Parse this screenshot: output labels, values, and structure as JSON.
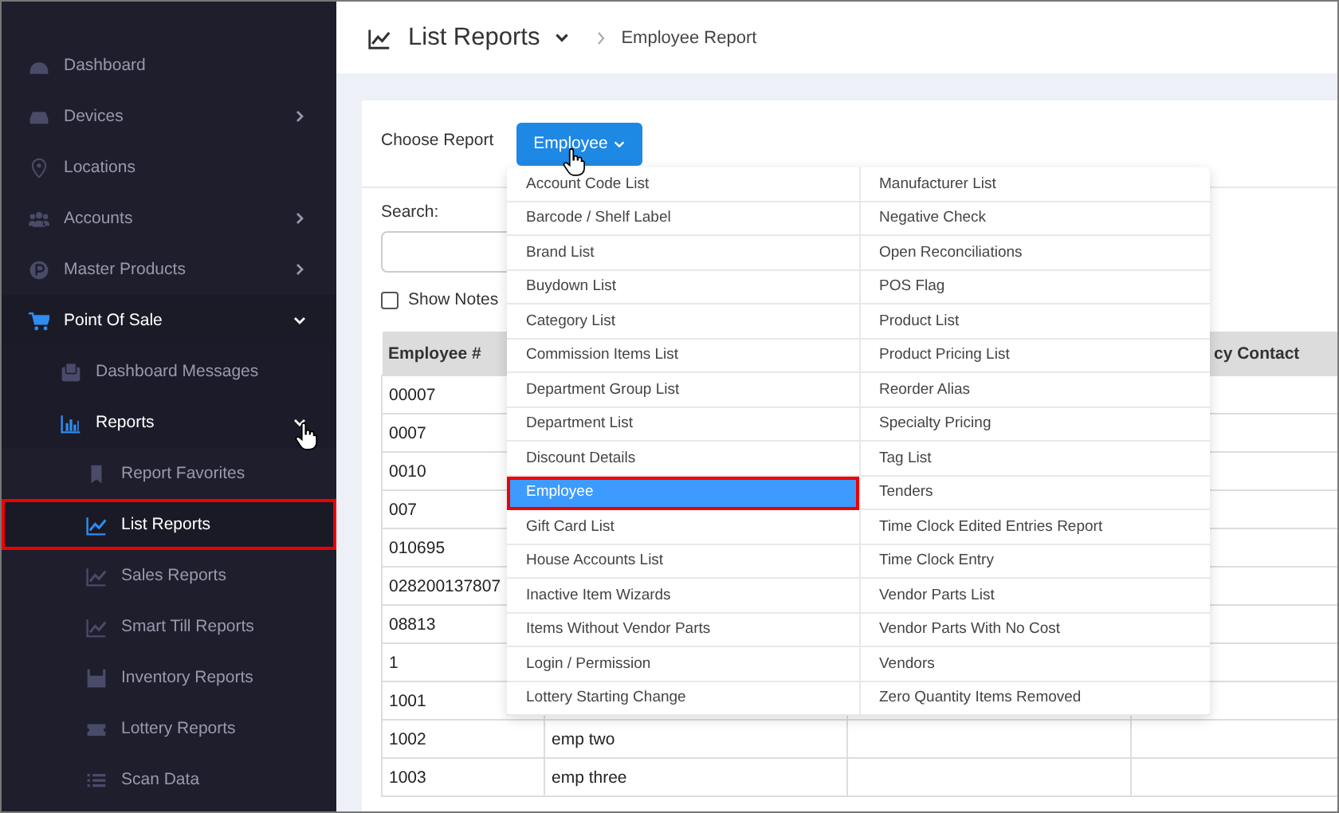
{
  "sidebar": {
    "items": [
      {
        "label": "Dashboard"
      },
      {
        "label": "Devices",
        "expanded": false
      },
      {
        "label": "Locations"
      },
      {
        "label": "Accounts",
        "expanded": false
      },
      {
        "label": "Master Products",
        "expanded": false
      },
      {
        "label": "Point Of Sale",
        "expanded": true,
        "children": [
          {
            "label": "Dashboard Messages"
          },
          {
            "label": "Reports",
            "expanded": true,
            "children": [
              {
                "label": "Report Favorites",
                "selected": false,
                "outlined": false
              },
              {
                "label": "List Reports",
                "selected": true,
                "outlined": true
              },
              {
                "label": "Sales Reports",
                "selected": false,
                "outlined": false
              },
              {
                "label": "Smart Till Reports",
                "selected": false,
                "outlined": false
              },
              {
                "label": "Inventory Reports",
                "selected": false,
                "outlined": false
              },
              {
                "label": "Lottery Reports",
                "selected": false,
                "outlined": false
              },
              {
                "label": "Scan Data",
                "selected": false,
                "outlined": false
              }
            ]
          }
        ]
      }
    ]
  },
  "header": {
    "title": "List Reports",
    "breadcrumb": "Employee Report"
  },
  "report_picker": {
    "label": "Choose Report",
    "value": "Employee",
    "options": [
      {
        "label": "Account Code List",
        "selected": false
      },
      {
        "label": "Barcode / Shelf Label",
        "selected": false
      },
      {
        "label": "Brand List",
        "selected": false
      },
      {
        "label": "Buydown List",
        "selected": false
      },
      {
        "label": "Category List",
        "selected": false
      },
      {
        "label": "Commission Items List",
        "selected": false
      },
      {
        "label": "Department Group List",
        "selected": false
      },
      {
        "label": "Department List",
        "selected": false
      },
      {
        "label": "Discount Details",
        "selected": false
      },
      {
        "label": "Employee",
        "selected": true
      },
      {
        "label": "Gift Card List",
        "selected": false
      },
      {
        "label": "House Accounts List",
        "selected": false
      },
      {
        "label": "Inactive Item Wizards",
        "selected": false
      },
      {
        "label": "Items Without Vendor Parts",
        "selected": false
      },
      {
        "label": "Login / Permission",
        "selected": false
      },
      {
        "label": "Lottery Starting Change",
        "selected": false
      },
      {
        "label": "Manufacturer List",
        "selected": false
      },
      {
        "label": "Negative Check",
        "selected": false
      },
      {
        "label": "Open Reconciliations",
        "selected": false
      },
      {
        "label": "POS Flag",
        "selected": false
      },
      {
        "label": "Product List",
        "selected": false
      },
      {
        "label": "Product Pricing List",
        "selected": false
      },
      {
        "label": "Reorder Alias",
        "selected": false
      },
      {
        "label": "Specialty Pricing",
        "selected": false
      },
      {
        "label": "Tag List",
        "selected": false
      },
      {
        "label": "Tenders",
        "selected": false
      },
      {
        "label": "Time Clock Edited Entries Report",
        "selected": false
      },
      {
        "label": "Time Clock Entry",
        "selected": false
      },
      {
        "label": "Vendor Parts List",
        "selected": false
      },
      {
        "label": "Vendor Parts With No Cost",
        "selected": false
      },
      {
        "label": "Vendors",
        "selected": false
      },
      {
        "label": "Zero Quantity Items Removed",
        "selected": false
      }
    ]
  },
  "search": {
    "label": "Search:"
  },
  "show_notes": {
    "label": "Show Notes",
    "checked": false
  },
  "table": {
    "columns": [
      "Employee #",
      "",
      "",
      "cy Contact"
    ],
    "rows": [
      [
        "00007"
      ],
      [
        "0007"
      ],
      [
        "0010"
      ],
      [
        "007"
      ],
      [
        "010695"
      ],
      [
        "028200137807"
      ],
      [
        "08813"
      ],
      [
        "1"
      ],
      [
        "1001"
      ],
      [
        "1002",
        "emp two"
      ],
      [
        "1003",
        "emp three"
      ]
    ]
  }
}
